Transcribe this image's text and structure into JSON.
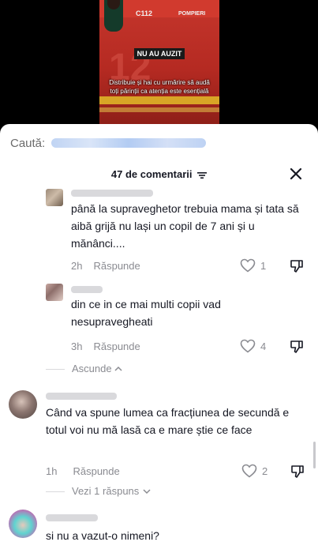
{
  "video": {
    "truck_label_left": "C112",
    "truck_label_right": "POMPIERI",
    "truck_number": "12",
    "title": "NU AU AUZIT",
    "caption_line1": "Distribuie și hai cu urmărire să audă",
    "caption_line2": "toți părinții ca atenția este esențială"
  },
  "search": {
    "label": "Caută:"
  },
  "comments_header": {
    "count_label": "47 de comentarii"
  },
  "comments": [
    {
      "text": "până la supraveghetor trebuia mama și tata să aibă grijă nu lași un copil de 7 ani și u mănânci....",
      "time": "2h",
      "reply_label": "Răspunde",
      "likes": "1"
    },
    {
      "text": "din ce in ce mai multi copii vad nesupravegheati",
      "time": "3h",
      "reply_label": "Răspunde",
      "likes": "4"
    },
    {
      "text": "Când va spune lumea ca fracțiunea de secundă e totul voi nu mă lasă ca e mare știe ce face",
      "time": "1h",
      "reply_label": "Răspunde",
      "likes": "2"
    },
    {
      "text": "si nu a vazut-o nimeni?"
    }
  ],
  "thread": {
    "collapse_label": "Ascunde",
    "view_replies_label": "Vezi 1 răspuns"
  },
  "colors": {
    "text": "#161823",
    "muted": "#8a8b91",
    "sheet": "#ffffff"
  }
}
